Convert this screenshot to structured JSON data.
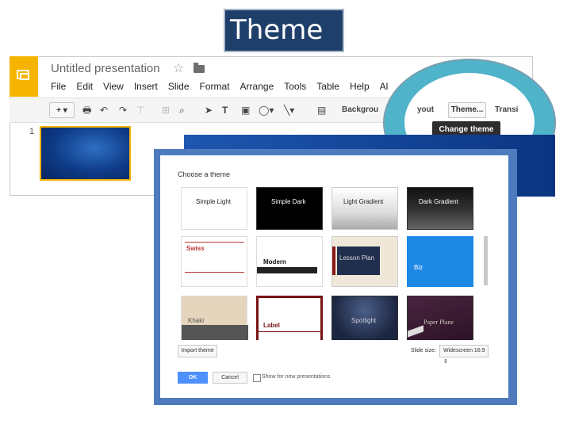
{
  "slide_title": "Theme",
  "app": {
    "doc_title": "Untitled presentation",
    "menu": [
      "File",
      "Edit",
      "View",
      "Insert",
      "Slide",
      "Format",
      "Arrange",
      "Tools",
      "Table",
      "Help",
      "Al"
    ],
    "toolbar": {
      "background_label": "Backgrou",
      "layout_label": "yout",
      "theme_label": "Theme...",
      "transition_label": "Transi"
    },
    "tooltip": "Change theme",
    "slide_number": "1"
  },
  "dialog": {
    "title": "Choose a theme",
    "themes": [
      {
        "name": "Simple Light"
      },
      {
        "name": "Simple Dark"
      },
      {
        "name": "Light Gradient"
      },
      {
        "name": "Dark Gradient"
      },
      {
        "name": "Swiss"
      },
      {
        "name": "Modern"
      },
      {
        "name": "Lesson Plan"
      },
      {
        "name": "Biz"
      },
      {
        "name": "Khaki"
      },
      {
        "name": "Label"
      },
      {
        "name": "Spotlight"
      },
      {
        "name": "Paper Plane"
      }
    ],
    "import_label": "Import theme",
    "slide_size_label": "Slide size:",
    "slide_size_value": "Widescreen 16:9",
    "ok_label": "OK",
    "cancel_label": "Cancel",
    "show_label": "Show for new presentations"
  },
  "colors": {
    "accent_yellow": "#f4b400",
    "highlight_ring": "#4fb3c9",
    "dialog_border": "#4d7bbd",
    "ok_blue": "#4d90fe"
  }
}
